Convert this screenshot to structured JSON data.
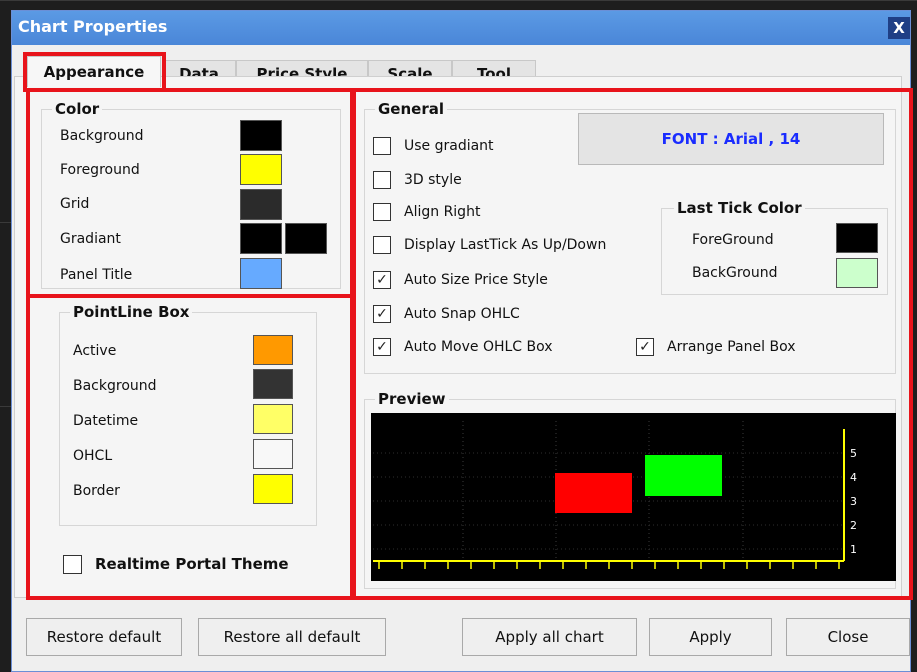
{
  "window": {
    "title": "Chart Properties",
    "close_glyph": "X"
  },
  "tabs": [
    {
      "label": "Appearance",
      "active": true
    },
    {
      "label": "Data"
    },
    {
      "label": "Price Style"
    },
    {
      "label": "Scale"
    },
    {
      "label": "Tool"
    }
  ],
  "color_group": {
    "title": "Color",
    "items": [
      {
        "label": "Background",
        "colors": [
          "#000000"
        ]
      },
      {
        "label": "Foreground",
        "colors": [
          "#ffff00"
        ]
      },
      {
        "label": "Grid",
        "colors": [
          "#2b2b2b"
        ]
      },
      {
        "label": "Gradiant",
        "colors": [
          "#000000",
          "#000000"
        ]
      },
      {
        "label": "Panel Title",
        "colors": [
          "#66aaff"
        ]
      }
    ]
  },
  "pointline_group": {
    "title": "PointLine Box",
    "items": [
      {
        "label": "Active",
        "color": "#ff9900"
      },
      {
        "label": "Background",
        "color": "#333333"
      },
      {
        "label": "Datetime",
        "color": "#ffff66"
      },
      {
        "label": "OHCL",
        "color": "#f8f8f8"
      },
      {
        "label": "Border",
        "color": "#ffff00"
      }
    ]
  },
  "realtime_theme": {
    "label": "Realtime Portal Theme",
    "checked": false
  },
  "general_group": {
    "title": "General",
    "checkboxes": [
      {
        "label": "Use gradiant",
        "checked": false
      },
      {
        "label": "3D style",
        "checked": false
      },
      {
        "label": "Align Right",
        "checked": false
      },
      {
        "label": "Display LastTick As Up/Down",
        "checked": false
      },
      {
        "label": "Auto Size Price Style",
        "checked": true
      },
      {
        "label": "Auto Snap OHLC",
        "checked": true
      },
      {
        "label": "Auto Move OHLC Box",
        "checked": true
      },
      {
        "label": "Arrange Panel Box",
        "checked": true
      }
    ],
    "font_button": "FONT : Arial , 14"
  },
  "last_tick_group": {
    "title": "Last Tick Color",
    "items": [
      {
        "label": "ForeGround",
        "color": "#000000"
      },
      {
        "label": "BackGround",
        "color": "#ccffcc"
      }
    ]
  },
  "preview": {
    "title": "Preview",
    "background": "#000000",
    "axis_color": "#ffff00",
    "y_ticks": [
      "5",
      "4",
      "3",
      "2",
      "1"
    ],
    "boxes": [
      {
        "color": "#ff0000"
      },
      {
        "color": "#00ff00"
      }
    ]
  },
  "buttons": [
    "Restore default",
    "Restore all default",
    "Apply all chart",
    "Apply",
    "Close"
  ],
  "highlight_color": "#e8141b"
}
